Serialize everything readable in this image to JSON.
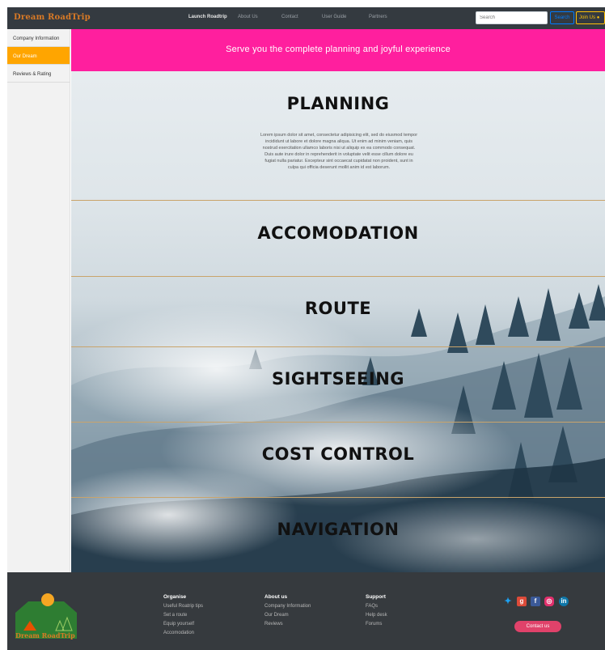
{
  "navbar": {
    "brand": "Dream RoadTrip",
    "links": [
      "Launch Roadtrip",
      "About Us",
      "Contact",
      "User Guide",
      "Partners"
    ],
    "search_placeholder": "Search",
    "search_button": "Search",
    "join_button": "Join Us"
  },
  "sidebar": {
    "items": [
      "Company Information",
      "Our Dream",
      "Reviews & Rating"
    ]
  },
  "banner": {
    "text": "Serve you the complete planning and joyful experience"
  },
  "sections": [
    {
      "title": "PLANNING"
    },
    {
      "title": "ACCOMODATION"
    },
    {
      "title": "ROUTE"
    },
    {
      "title": "SIGHTSEEING"
    },
    {
      "title": "COST CONTROL"
    },
    {
      "title": "NAVIGATION"
    }
  ],
  "lorem": "Lorem ipsum dolor sit amet, consectetur adipisicing elit, sed do eiusmod tempor incididunt ut labore et dolore magna aliqua. Ut enim ad minim veniam, quis nostrud exercitation ullamco laboris nisi ut aliquip ex ea commodo consequat. Duis aute irure dolor in reprehenderit in voluptate velit esse cillum dolore eu fugiat nulla pariatur. Excepteur sint occaecat cupidatat non proident, sunt in culpa qui officia deserunt mollit anim id est laborum.",
  "footer": {
    "logo_text": "Dream RoadTrip",
    "columns": [
      {
        "title": "Organise",
        "links": [
          "Useful Roatrip tips",
          "Set a route",
          "Equip yourself",
          "Accomodation"
        ]
      },
      {
        "title": "About us",
        "links": [
          "Company Information",
          "Our Dream",
          "Reviews"
        ]
      },
      {
        "title": "Support",
        "links": [
          "FAQs",
          "Help desk",
          "Forums"
        ]
      }
    ],
    "social_icons": [
      "twitter-icon",
      "google-plus-icon",
      "facebook-icon",
      "instagram-icon",
      "linkedin-icon"
    ],
    "contact_button": "Contact us"
  },
  "colors": {
    "banner": "#ff1f9e",
    "brand": "#d97a26",
    "active_sidebar": "#ffa500",
    "footer": "#363a3e",
    "contact_button": "#e0426a"
  }
}
